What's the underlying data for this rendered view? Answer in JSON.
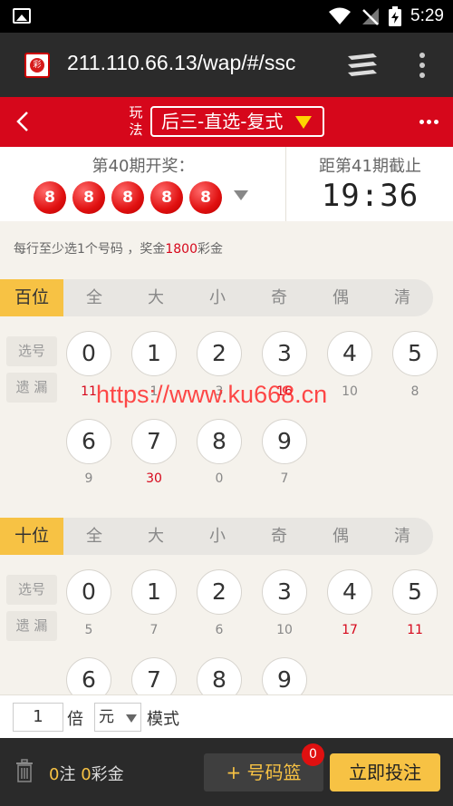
{
  "status_bar": {
    "time": "5:29"
  },
  "browser": {
    "url": "211.110.66.13/wap/#/ssc"
  },
  "header": {
    "play_label_1": "玩",
    "play_label_2": "法",
    "mode": "后三-直选-复式"
  },
  "draw": {
    "title": "第40期开奖：",
    "numbers": [
      "8",
      "8",
      "8",
      "8",
      "8"
    ],
    "next_label": "距第41期截止",
    "countdown": "19:36"
  },
  "hint": {
    "prefix": "每行至少选1个号码 ，奖金",
    "amount": "1800",
    "suffix": "彩金"
  },
  "filters": [
    "全",
    "大",
    "小",
    "奇",
    "偶",
    "清"
  ],
  "side_labels": {
    "select": "选号",
    "miss": "遗 漏"
  },
  "sections": [
    {
      "label": "百位",
      "digits": [
        "0",
        "1",
        "2",
        "3",
        "4",
        "5",
        "6",
        "7",
        "8",
        "9"
      ],
      "miss": [
        "11",
        "1",
        "3",
        "16",
        "10",
        "8",
        "9",
        "30",
        "0",
        "7"
      ],
      "hot": [
        true,
        false,
        false,
        true,
        false,
        false,
        false,
        true,
        false,
        false
      ]
    },
    {
      "label": "十位",
      "digits": [
        "0",
        "1",
        "2",
        "3",
        "4",
        "5",
        "6",
        "7",
        "8",
        "9"
      ],
      "miss": [
        "5",
        "7",
        "6",
        "10",
        "17",
        "11"
      ],
      "hot": [
        false,
        false,
        false,
        false,
        true,
        true
      ]
    }
  ],
  "watermark": "https://www.ku668.cn",
  "multiplier": {
    "value": "1",
    "label": "倍",
    "unit": "元",
    "mode_label": "模式"
  },
  "bottom": {
    "bets": "0",
    "bets_unit": "注",
    "money": "0",
    "money_unit": "彩金",
    "basket": "+ 号码篮",
    "badge": "0",
    "submit": "立即投注"
  },
  "colors": {
    "header_red": "#d6071b",
    "accent_yellow": "#f7c244",
    "ball_red": "#e01010"
  }
}
